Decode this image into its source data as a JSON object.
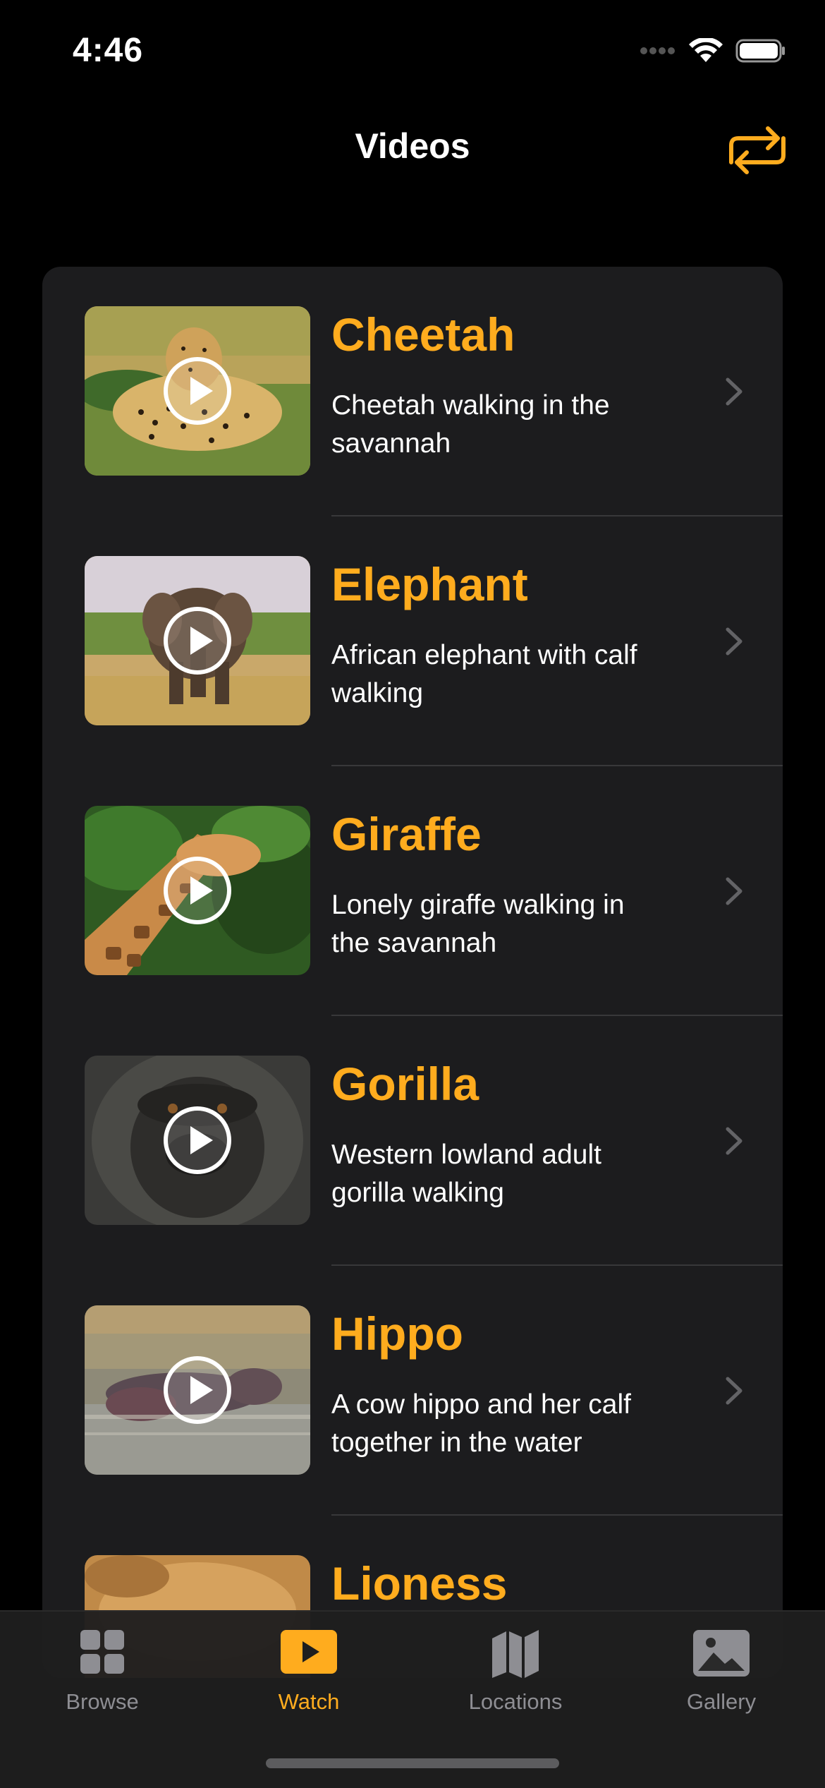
{
  "status_bar": {
    "time": "4:46"
  },
  "nav": {
    "title": "Videos",
    "action_icon": "shuffle-icon"
  },
  "videos": [
    {
      "title": "Cheetah",
      "description": "Cheetah walking in the savannah"
    },
    {
      "title": "Elephant",
      "description": "African elephant with calf walking"
    },
    {
      "title": "Giraffe",
      "description": "Lonely giraffe walking in the savannah"
    },
    {
      "title": "Gorilla",
      "description": "Western lowland adult gorilla walking"
    },
    {
      "title": "Hippo",
      "description": "A cow hippo and her calf together in the water"
    },
    {
      "title": "Lioness",
      "description": ""
    }
  ],
  "tabs": [
    {
      "label": "Browse",
      "icon": "grid-icon",
      "active": false
    },
    {
      "label": "Watch",
      "icon": "play-rectangle-icon",
      "active": true
    },
    {
      "label": "Locations",
      "icon": "map-icon",
      "active": false
    },
    {
      "label": "Gallery",
      "icon": "photo-icon",
      "active": false
    }
  ],
  "colors": {
    "accent": "#ffac1e",
    "background": "#000000",
    "card": "#1c1c1e",
    "inactive": "#8e8e93"
  }
}
